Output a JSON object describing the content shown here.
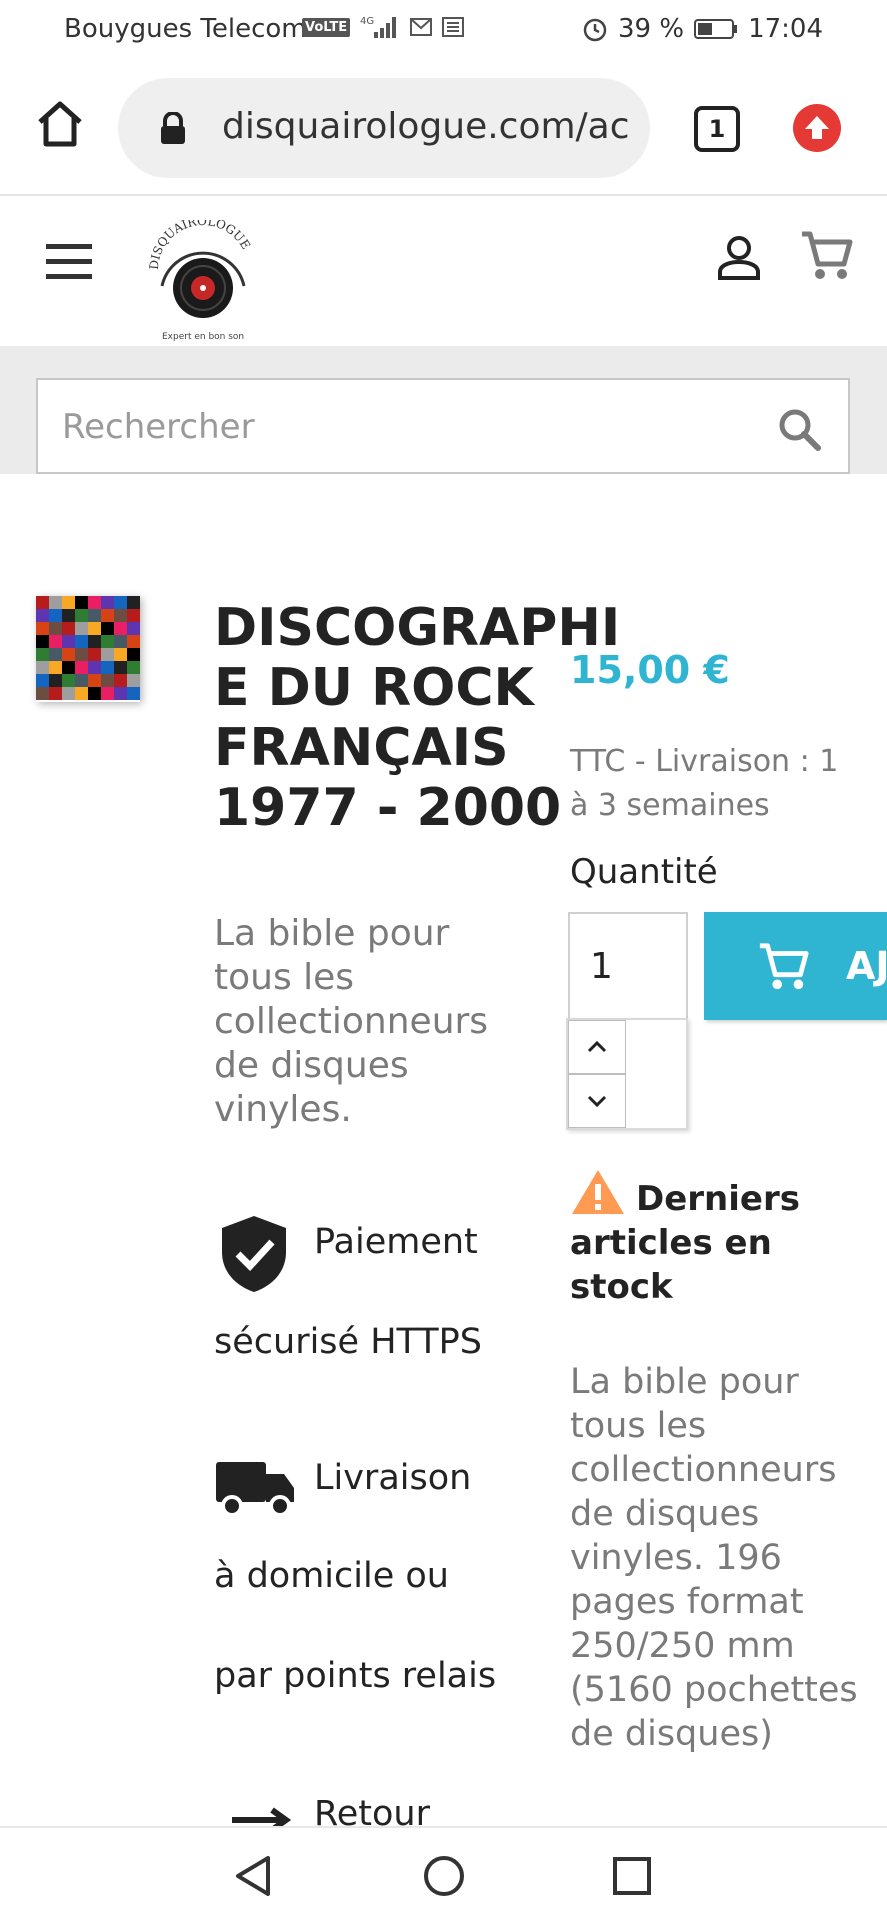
{
  "status_bar": {
    "carrier": "Bouygues Telecom",
    "volte": "VoLTE",
    "network": "4G",
    "battery": "39 %",
    "time": "17:04"
  },
  "browser": {
    "url": "disquairologue.com/ac",
    "tab_count": "1"
  },
  "site": {
    "logo_name": "DISQUAIROLOGUE",
    "logo_tagline": "Expert en bon son",
    "search_placeholder": "Rechercher"
  },
  "product": {
    "title": "DISCOGRAPHIE DU ROCK FRANÇAIS 1977 - 2000",
    "subtitle": "La bible pour tous les collectionneurs de disques vinyles.",
    "price": "15,00 €",
    "tax_delivery": "TTC  - Livraison : 1 à 3 semaines",
    "quantity_label": "Quantité",
    "quantity_value": "1",
    "add_to_cart_label": "AJ",
    "stock_notice": "Derniers articles en stock",
    "description": "La bible pour tous les collectionneurs de disques vinyles. 196 pages format 250/250 mm (5160 pochettes de disques)"
  },
  "reassurance": [
    {
      "icon": "shield-check-icon",
      "line1": "Paiement",
      "line2": "sécurisé HTTPS"
    },
    {
      "icon": "truck-icon",
      "line1": "Livraison",
      "line2": "à domicile ou",
      "line3": "par points relais"
    },
    {
      "icon": "return-arrows-icon",
      "line1": "Retour"
    }
  ],
  "colors": {
    "accent": "#2fb5d2",
    "warning": "#ff9a52",
    "update": "#e53935"
  }
}
